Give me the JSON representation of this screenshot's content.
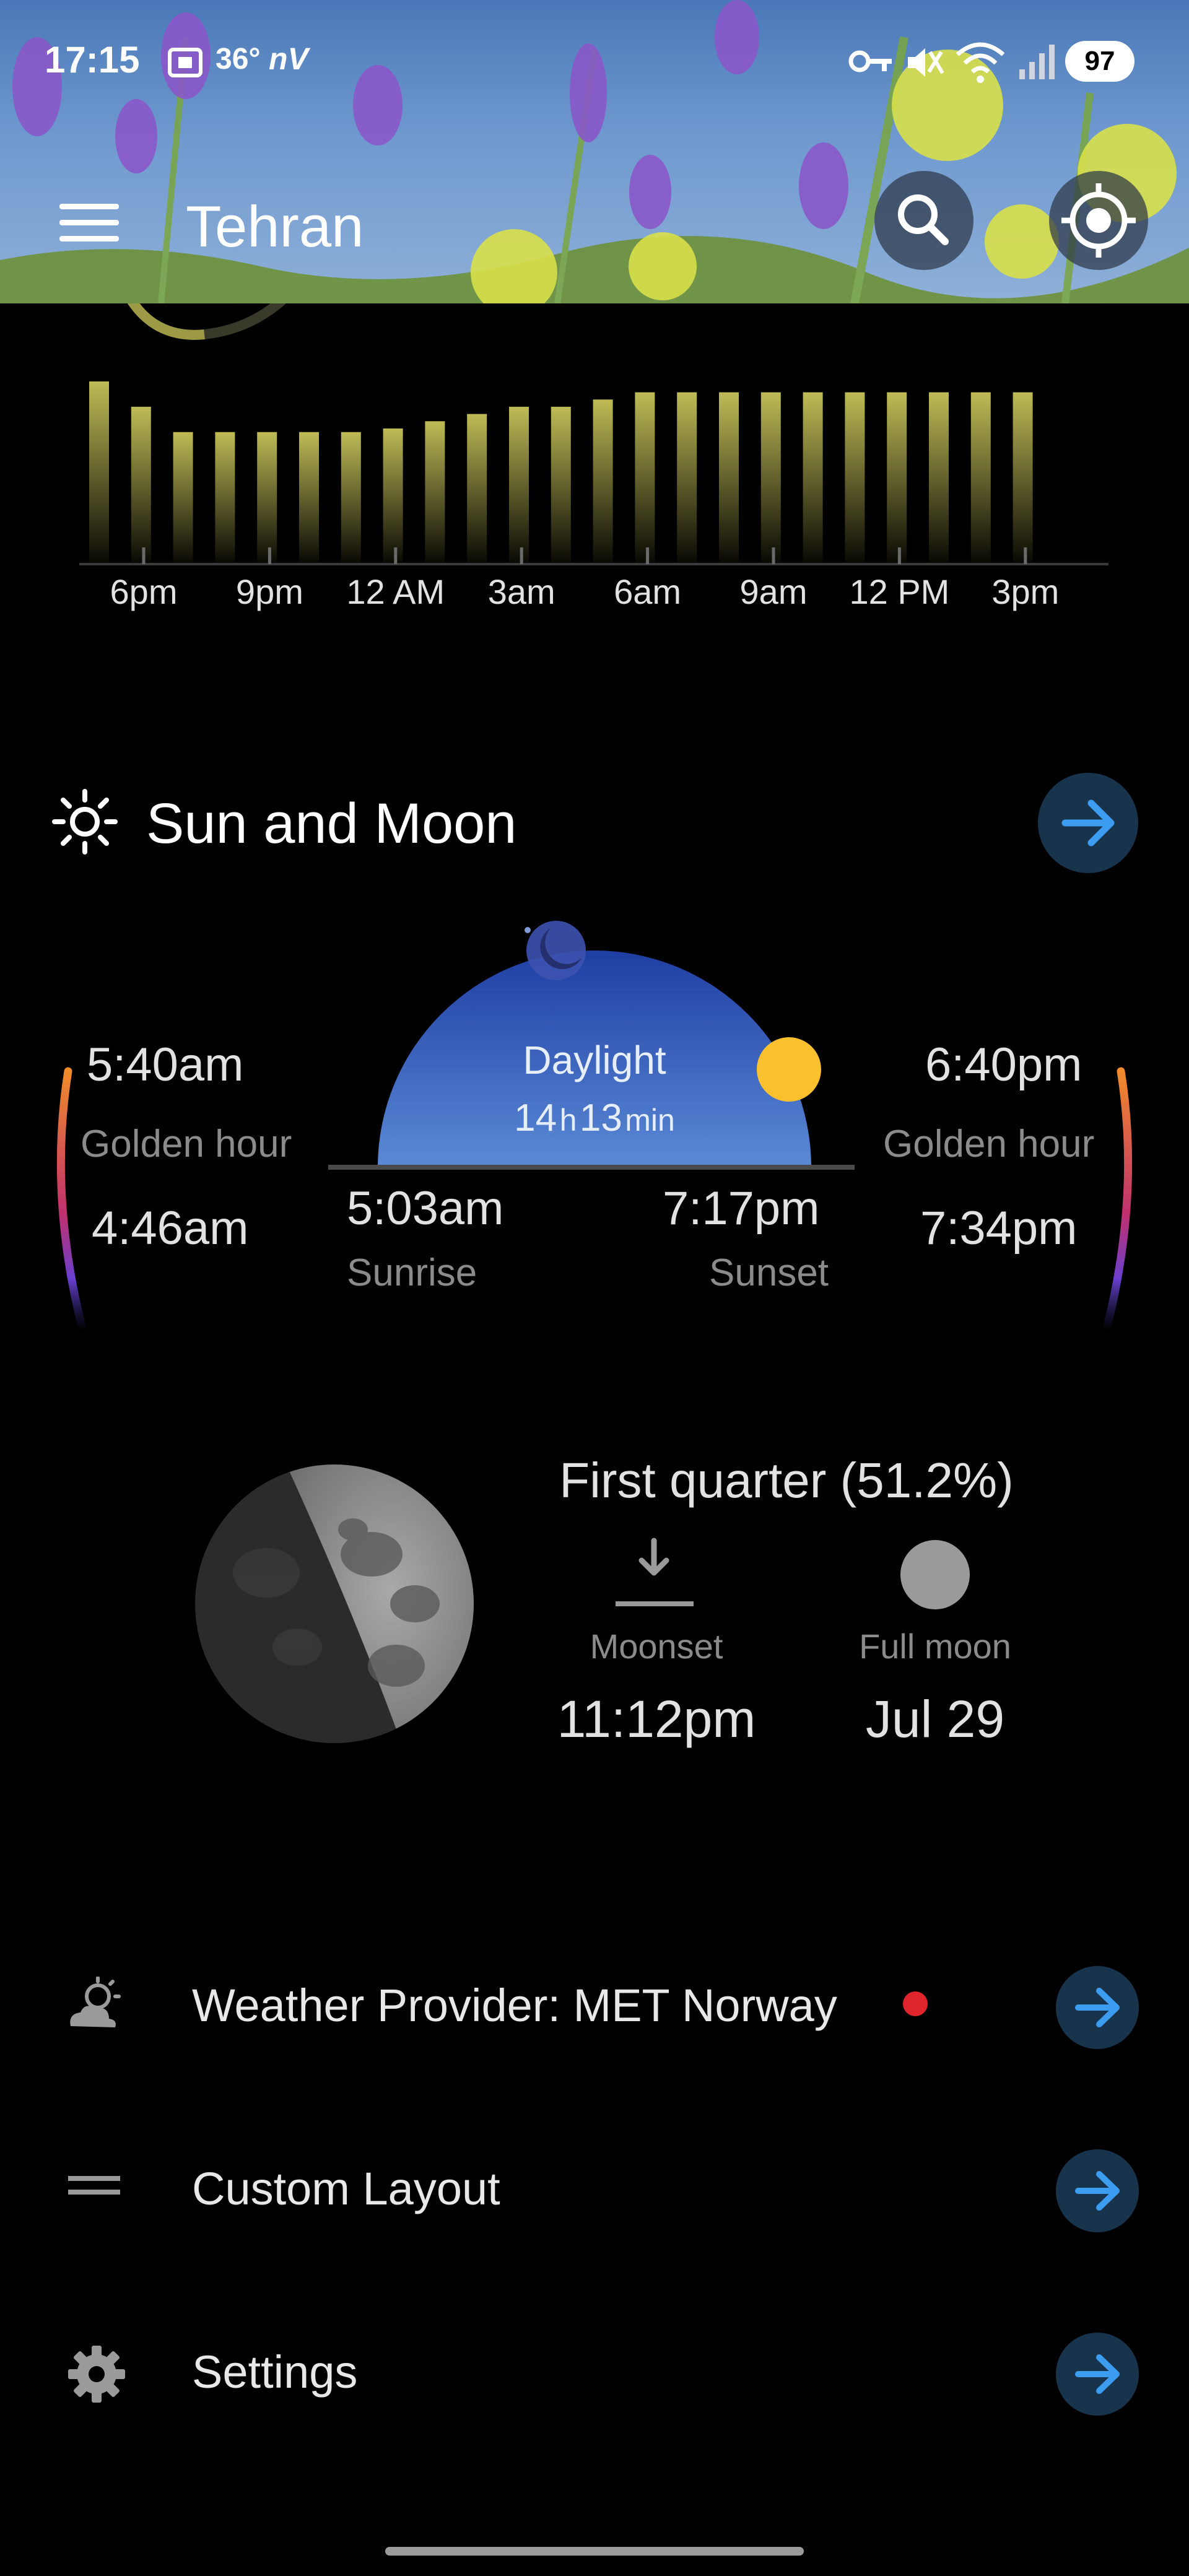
{
  "status_bar": {
    "time": "17:15",
    "temperature": "36°",
    "carrier_badge": "nV",
    "battery": "97",
    "icons": [
      "screen-record-icon",
      "vpn-key-icon",
      "mute-icon",
      "wifi-icon",
      "signal-icon"
    ]
  },
  "header": {
    "city": "Tehran",
    "icons": [
      "menu-icon",
      "search-icon",
      "my-location-icon"
    ]
  },
  "air_quality_chart": {
    "chart_data": {
      "type": "bar",
      "x": [
        "6pm",
        "7pm",
        "8pm",
        "9pm",
        "10pm",
        "11pm",
        "12 AM",
        "1am",
        "2am",
        "3am",
        "4am",
        "5am",
        "6am",
        "7am",
        "8am",
        "9am",
        "10am",
        "11am",
        "12 PM",
        "1pm",
        "2pm",
        "3pm",
        "4pm"
      ],
      "x_tick_labels": [
        "6pm",
        "9pm",
        "12 AM",
        "3am",
        "6am",
        "9am",
        "12 PM",
        "3pm"
      ],
      "values": [
        100,
        86,
        72,
        72,
        72,
        72,
        72,
        74,
        78,
        82,
        86,
        86,
        90,
        94,
        94,
        94,
        94,
        94,
        94,
        94,
        94,
        94,
        94
      ],
      "values_note": "relative bar heights; no value axis is printed",
      "title": "",
      "xlabel": "",
      "ylabel": "",
      "bar_color": "#c8c55a",
      "grid": false
    }
  },
  "sun_moon": {
    "title": "Sun and Moon",
    "dawn_golden_hour_end": "5:40am",
    "dawn_golden_hour_label": "Golden hour",
    "dawn_golden_hour_start": "4:46am",
    "daylight_label": "Daylight",
    "daylight_hours": "14",
    "daylight_hours_unit": "h",
    "daylight_minutes": "13",
    "daylight_minutes_unit": "min",
    "sunrise_time": "5:03am",
    "sunrise_label": "Sunrise",
    "sunset_time": "7:17pm",
    "sunset_label": "Sunset",
    "dusk_golden_hour_start": "6:40pm",
    "dusk_golden_hour_label": "Golden hour",
    "dusk_golden_hour_end": "7:34pm",
    "moon_phase": "First quarter (51.2%)",
    "moonset_label": "Moonset",
    "moonset_time": "11:12pm",
    "full_moon_label": "Full moon",
    "full_moon_date": "Jul 29",
    "colors": {
      "sun": "#fbc02d",
      "sky_top": "#1f3ea3",
      "sky_bottom": "#5b8ad6"
    }
  },
  "menu_list": [
    {
      "label": "Weather Provider: MET Norway",
      "icon": "partly-cloudy-icon",
      "has_alert_dot": true
    },
    {
      "label": "Custom Layout",
      "icon": "layout-icon",
      "has_alert_dot": false
    },
    {
      "label": "Settings",
      "icon": "gear-icon",
      "has_alert_dot": false
    }
  ],
  "colors": {
    "background": "#000000",
    "accent_arrow": "#3b9cf0",
    "arrow_button_bg": "#18344d"
  }
}
